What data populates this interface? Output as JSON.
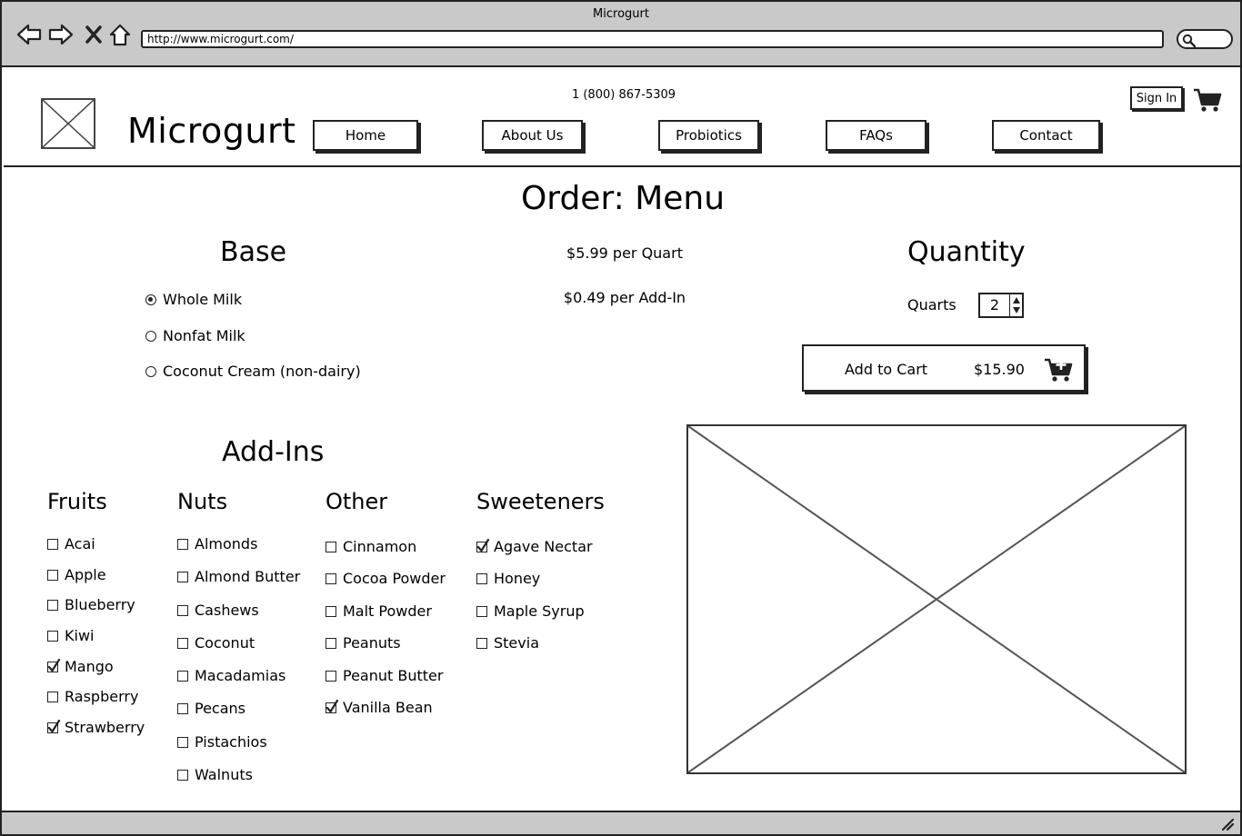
{
  "browser": {
    "window_title": "Microgurt",
    "url": "http://www.microgurt.com/",
    "icons": [
      "back-icon",
      "forward-icon",
      "stop-icon",
      "home-icon",
      "search-icon",
      "resize-grip-icon"
    ]
  },
  "header": {
    "brand": "Microgurt",
    "phone": "1 (800) 867-5309",
    "nav": [
      "Home",
      "About Us",
      "Probiotics",
      "FAQs",
      "Contact"
    ],
    "sign_in": "Sign In",
    "cart_icon": "cart-icon",
    "logo_icon": "image-placeholder-icon"
  },
  "page": {
    "title": "Order: Menu"
  },
  "base": {
    "title": "Base",
    "options": [
      {
        "label": "Whole Milk",
        "selected": true
      },
      {
        "label": "Nonfat Milk",
        "selected": false
      },
      {
        "label": "Coconut Cream (non-dairy)",
        "selected": false
      }
    ]
  },
  "pricing": {
    "per_quart": "$5.99 per Quart",
    "per_addin": "$0.49 per Add-In"
  },
  "quantity": {
    "title": "Quantity",
    "label": "Quarts",
    "value": "2"
  },
  "cart": {
    "button_label": "Add to Cart",
    "total": "$15.90",
    "icon": "cart-add-icon"
  },
  "addins": {
    "title": "Add-Ins",
    "columns": [
      {
        "title": "Fruits",
        "items": [
          {
            "label": "Acai",
            "checked": false
          },
          {
            "label": "Apple",
            "checked": false
          },
          {
            "label": "Blueberry",
            "checked": false
          },
          {
            "label": "Kiwi",
            "checked": false
          },
          {
            "label": "Mango",
            "checked": true
          },
          {
            "label": "Raspberry",
            "checked": false
          },
          {
            "label": "Strawberry",
            "checked": true
          }
        ]
      },
      {
        "title": "Nuts",
        "items": [
          {
            "label": "Almonds",
            "checked": false
          },
          {
            "label": "Almond Butter",
            "checked": false
          },
          {
            "label": "Cashews",
            "checked": false
          },
          {
            "label": "Coconut",
            "checked": false
          },
          {
            "label": "Macadamias",
            "checked": false
          },
          {
            "label": "Pecans",
            "checked": false
          },
          {
            "label": "Pistachios",
            "checked": false
          },
          {
            "label": "Walnuts",
            "checked": false
          }
        ]
      },
      {
        "title": "Other",
        "items": [
          {
            "label": "Cinnamon",
            "checked": false
          },
          {
            "label": "Cocoa Powder",
            "checked": false
          },
          {
            "label": "Malt Powder",
            "checked": false
          },
          {
            "label": "Peanuts",
            "checked": false
          },
          {
            "label": "Peanut Butter",
            "checked": false
          },
          {
            "label": "Vanilla Bean",
            "checked": true
          }
        ]
      },
      {
        "title": "Sweeteners",
        "items": [
          {
            "label": "Agave Nectar",
            "checked": true
          },
          {
            "label": "Honey",
            "checked": false
          },
          {
            "label": "Maple Syrup",
            "checked": false
          },
          {
            "label": "Stevia",
            "checked": false
          }
        ]
      }
    ]
  },
  "product_image": {
    "icon": "image-placeholder-icon"
  },
  "colors": {
    "chrome": "#c9c9c9",
    "ink": "#222222",
    "background": "#ffffff"
  }
}
